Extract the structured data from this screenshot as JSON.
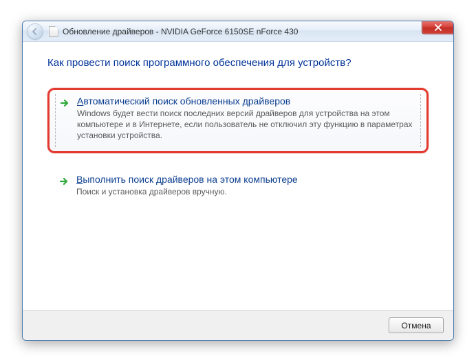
{
  "window": {
    "title": "Обновление драйверов - NVIDIA GeForce 6150SE nForce 430"
  },
  "heading": "Как провести поиск программного обеспечения для устройств?",
  "options": [
    {
      "accel": "А",
      "title_rest": "втоматический поиск обновленных драйверов",
      "desc": "Windows будет вести поиск последних версий драйверов для устройства на этом компьютере и в Интернете, если пользователь не отключил эту функцию в параметрах установки устройства."
    },
    {
      "accel": "В",
      "title_rest": "ыполнить поиск драйверов на этом компьютере",
      "desc": "Поиск и установка драйверов вручную."
    }
  ],
  "footer": {
    "cancel": "Отмена"
  }
}
